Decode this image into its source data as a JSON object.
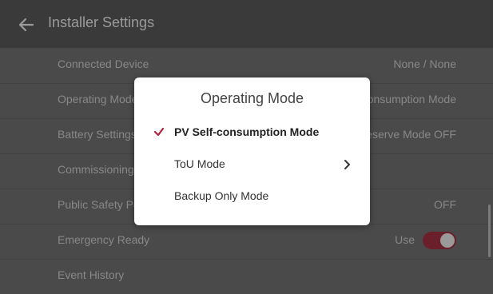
{
  "header": {
    "title": "Installer Settings",
    "back_icon": "back-arrow-icon"
  },
  "rows": [
    {
      "label": "Connected Device",
      "value": "None / None"
    },
    {
      "label": "Operating Mode",
      "value": "PV Self-consumption Mode"
    },
    {
      "label": "Battery Settings",
      "value": "Reserve Mode OFF"
    },
    {
      "label": "Commissioning",
      "value": ""
    },
    {
      "label": "Public Safety Power Shutoff",
      "value": "OFF"
    },
    {
      "label": "Emergency Ready",
      "value": "Use",
      "toggle_on": true
    },
    {
      "label": "Event History",
      "value": ""
    }
  ],
  "modal": {
    "title": "Operating Mode",
    "options": [
      {
        "label": "PV Self-consumption Mode",
        "selected": true
      },
      {
        "label": "ToU Mode",
        "has_submenu": true
      },
      {
        "label": "Backup Only Mode"
      }
    ]
  },
  "colors": {
    "accent": "#b3213a",
    "toggle_bg": "#6a1f2b",
    "overlay_bg": "#4a4a4a",
    "header_bg": "#3a3a3a"
  }
}
